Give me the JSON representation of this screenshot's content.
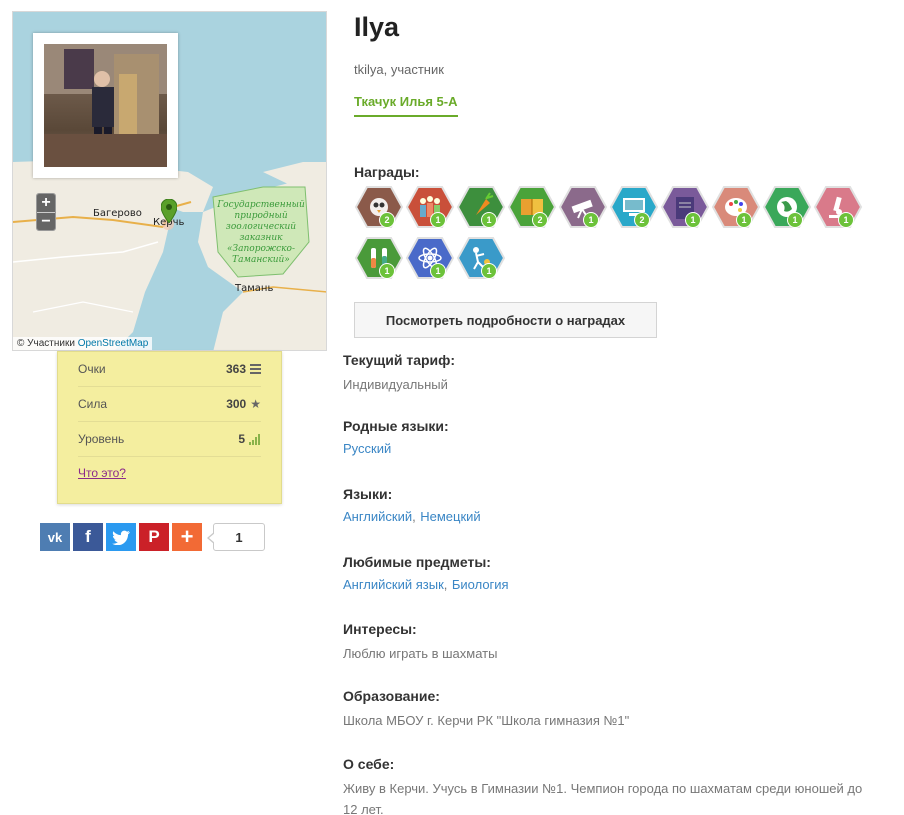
{
  "map": {
    "attribution_prefix": "© Участники",
    "attribution_link": "OpenStreetMap",
    "zoom_in": "+",
    "zoom_out": "−",
    "labels": {
      "bagerovo": "Багерово",
      "kerch": "Керчь",
      "taman": "Тамань",
      "reserve": "Государственный природный зоологический заказник «Запорожско-Таманский»"
    }
  },
  "stats": {
    "points_label": "Очки",
    "points_value": "363",
    "power_label": "Сила",
    "power_value": "300",
    "level_label": "Уровень",
    "level_value": "5",
    "what_link": "Что это?"
  },
  "share": {
    "vk": "vk",
    "fb": "f",
    "tw": "t",
    "pi": "P",
    "plus": "+",
    "count": "1"
  },
  "profile": {
    "name": "Ilya",
    "subtitle": "tkilya, участник",
    "class_link": "Ткачук Илья 5-А"
  },
  "awards": {
    "title": "Награды:",
    "details_button": "Посмотреть подробности о наградах",
    "badges": [
      {
        "icon": "owl-icon",
        "count": "2",
        "color": "#8b5a4a"
      },
      {
        "icon": "people-icon",
        "count": "1",
        "color": "#c9503a"
      },
      {
        "icon": "carrot-icon",
        "count": "1",
        "color": "#3d8f3d"
      },
      {
        "icon": "book-icon",
        "count": "2",
        "color": "#4aa33a"
      },
      {
        "icon": "telescope-icon",
        "count": "1",
        "color": "#8b6a8b"
      },
      {
        "icon": "computer-icon",
        "count": "2",
        "color": "#2aa8c9"
      },
      {
        "icon": "notebook-icon",
        "count": "1",
        "color": "#7a5a9a"
      },
      {
        "icon": "palette-icon",
        "count": "1",
        "color": "#d98a7a"
      },
      {
        "icon": "globe-icon",
        "count": "1",
        "color": "#3aa85a"
      },
      {
        "icon": "microscope-icon",
        "count": "1",
        "color": "#d97a8a"
      },
      {
        "icon": "test-tubes-icon",
        "count": "1",
        "color": "#4a9a3a"
      },
      {
        "icon": "atom-icon",
        "count": "1",
        "color": "#4a6ac9"
      },
      {
        "icon": "sport-icon",
        "count": "1",
        "color": "#3a9ac9"
      }
    ]
  },
  "fields": {
    "tariff_label": "Текущий тариф:",
    "tariff_value": "Индивидуальный",
    "native_label": "Родные языки:",
    "native_value": "Русский",
    "langs_label": "Языки:",
    "langs_1": "Английский",
    "langs_2": "Немецкий",
    "subjects_label": "Любимые предметы:",
    "subjects_1": "Английский язык",
    "subjects_2": "Биология",
    "interests_label": "Интересы:",
    "interests_value": "Люблю играть в шахматы",
    "edu_label": "Образование:",
    "edu_value": "Школа МБОУ г. Керчи РК \"Школа гимназия №1\"",
    "about_label": "О себе:",
    "about_value": "Живу в Керчи. Учусь в Гимназии №1. Чемпион города по шахматам среди юношей до 12 лет.",
    "separator": ","
  }
}
